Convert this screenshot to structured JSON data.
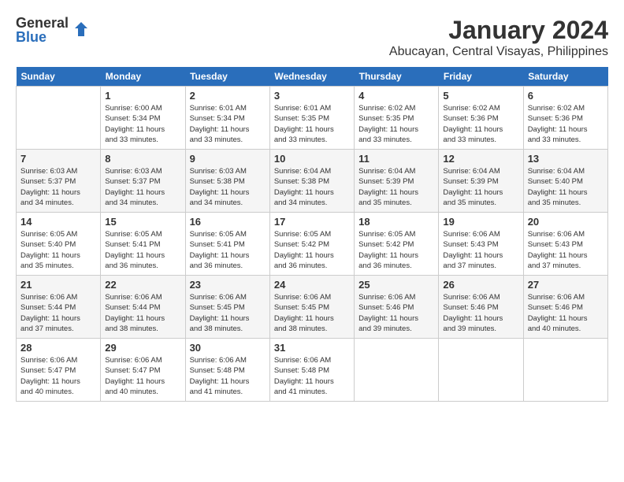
{
  "header": {
    "logo_general": "General",
    "logo_blue": "Blue",
    "month_title": "January 2024",
    "location": "Abucayan, Central Visayas, Philippines"
  },
  "days_of_week": [
    "Sunday",
    "Monday",
    "Tuesday",
    "Wednesday",
    "Thursday",
    "Friday",
    "Saturday"
  ],
  "weeks": [
    [
      {
        "day": "",
        "info": ""
      },
      {
        "day": "1",
        "info": "Sunrise: 6:00 AM\nSunset: 5:34 PM\nDaylight: 11 hours\nand 33 minutes."
      },
      {
        "day": "2",
        "info": "Sunrise: 6:01 AM\nSunset: 5:34 PM\nDaylight: 11 hours\nand 33 minutes."
      },
      {
        "day": "3",
        "info": "Sunrise: 6:01 AM\nSunset: 5:35 PM\nDaylight: 11 hours\nand 33 minutes."
      },
      {
        "day": "4",
        "info": "Sunrise: 6:02 AM\nSunset: 5:35 PM\nDaylight: 11 hours\nand 33 minutes."
      },
      {
        "day": "5",
        "info": "Sunrise: 6:02 AM\nSunset: 5:36 PM\nDaylight: 11 hours\nand 33 minutes."
      },
      {
        "day": "6",
        "info": "Sunrise: 6:02 AM\nSunset: 5:36 PM\nDaylight: 11 hours\nand 33 minutes."
      }
    ],
    [
      {
        "day": "7",
        "info": "Sunrise: 6:03 AM\nSunset: 5:37 PM\nDaylight: 11 hours\nand 34 minutes."
      },
      {
        "day": "8",
        "info": "Sunrise: 6:03 AM\nSunset: 5:37 PM\nDaylight: 11 hours\nand 34 minutes."
      },
      {
        "day": "9",
        "info": "Sunrise: 6:03 AM\nSunset: 5:38 PM\nDaylight: 11 hours\nand 34 minutes."
      },
      {
        "day": "10",
        "info": "Sunrise: 6:04 AM\nSunset: 5:38 PM\nDaylight: 11 hours\nand 34 minutes."
      },
      {
        "day": "11",
        "info": "Sunrise: 6:04 AM\nSunset: 5:39 PM\nDaylight: 11 hours\nand 35 minutes."
      },
      {
        "day": "12",
        "info": "Sunrise: 6:04 AM\nSunset: 5:39 PM\nDaylight: 11 hours\nand 35 minutes."
      },
      {
        "day": "13",
        "info": "Sunrise: 6:04 AM\nSunset: 5:40 PM\nDaylight: 11 hours\nand 35 minutes."
      }
    ],
    [
      {
        "day": "14",
        "info": "Sunrise: 6:05 AM\nSunset: 5:40 PM\nDaylight: 11 hours\nand 35 minutes."
      },
      {
        "day": "15",
        "info": "Sunrise: 6:05 AM\nSunset: 5:41 PM\nDaylight: 11 hours\nand 36 minutes."
      },
      {
        "day": "16",
        "info": "Sunrise: 6:05 AM\nSunset: 5:41 PM\nDaylight: 11 hours\nand 36 minutes."
      },
      {
        "day": "17",
        "info": "Sunrise: 6:05 AM\nSunset: 5:42 PM\nDaylight: 11 hours\nand 36 minutes."
      },
      {
        "day": "18",
        "info": "Sunrise: 6:05 AM\nSunset: 5:42 PM\nDaylight: 11 hours\nand 36 minutes."
      },
      {
        "day": "19",
        "info": "Sunrise: 6:06 AM\nSunset: 5:43 PM\nDaylight: 11 hours\nand 37 minutes."
      },
      {
        "day": "20",
        "info": "Sunrise: 6:06 AM\nSunset: 5:43 PM\nDaylight: 11 hours\nand 37 minutes."
      }
    ],
    [
      {
        "day": "21",
        "info": "Sunrise: 6:06 AM\nSunset: 5:44 PM\nDaylight: 11 hours\nand 37 minutes."
      },
      {
        "day": "22",
        "info": "Sunrise: 6:06 AM\nSunset: 5:44 PM\nDaylight: 11 hours\nand 38 minutes."
      },
      {
        "day": "23",
        "info": "Sunrise: 6:06 AM\nSunset: 5:45 PM\nDaylight: 11 hours\nand 38 minutes."
      },
      {
        "day": "24",
        "info": "Sunrise: 6:06 AM\nSunset: 5:45 PM\nDaylight: 11 hours\nand 38 minutes."
      },
      {
        "day": "25",
        "info": "Sunrise: 6:06 AM\nSunset: 5:46 PM\nDaylight: 11 hours\nand 39 minutes."
      },
      {
        "day": "26",
        "info": "Sunrise: 6:06 AM\nSunset: 5:46 PM\nDaylight: 11 hours\nand 39 minutes."
      },
      {
        "day": "27",
        "info": "Sunrise: 6:06 AM\nSunset: 5:46 PM\nDaylight: 11 hours\nand 40 minutes."
      }
    ],
    [
      {
        "day": "28",
        "info": "Sunrise: 6:06 AM\nSunset: 5:47 PM\nDaylight: 11 hours\nand 40 minutes."
      },
      {
        "day": "29",
        "info": "Sunrise: 6:06 AM\nSunset: 5:47 PM\nDaylight: 11 hours\nand 40 minutes."
      },
      {
        "day": "30",
        "info": "Sunrise: 6:06 AM\nSunset: 5:48 PM\nDaylight: 11 hours\nand 41 minutes."
      },
      {
        "day": "31",
        "info": "Sunrise: 6:06 AM\nSunset: 5:48 PM\nDaylight: 11 hours\nand 41 minutes."
      },
      {
        "day": "",
        "info": ""
      },
      {
        "day": "",
        "info": ""
      },
      {
        "day": "",
        "info": ""
      }
    ]
  ]
}
